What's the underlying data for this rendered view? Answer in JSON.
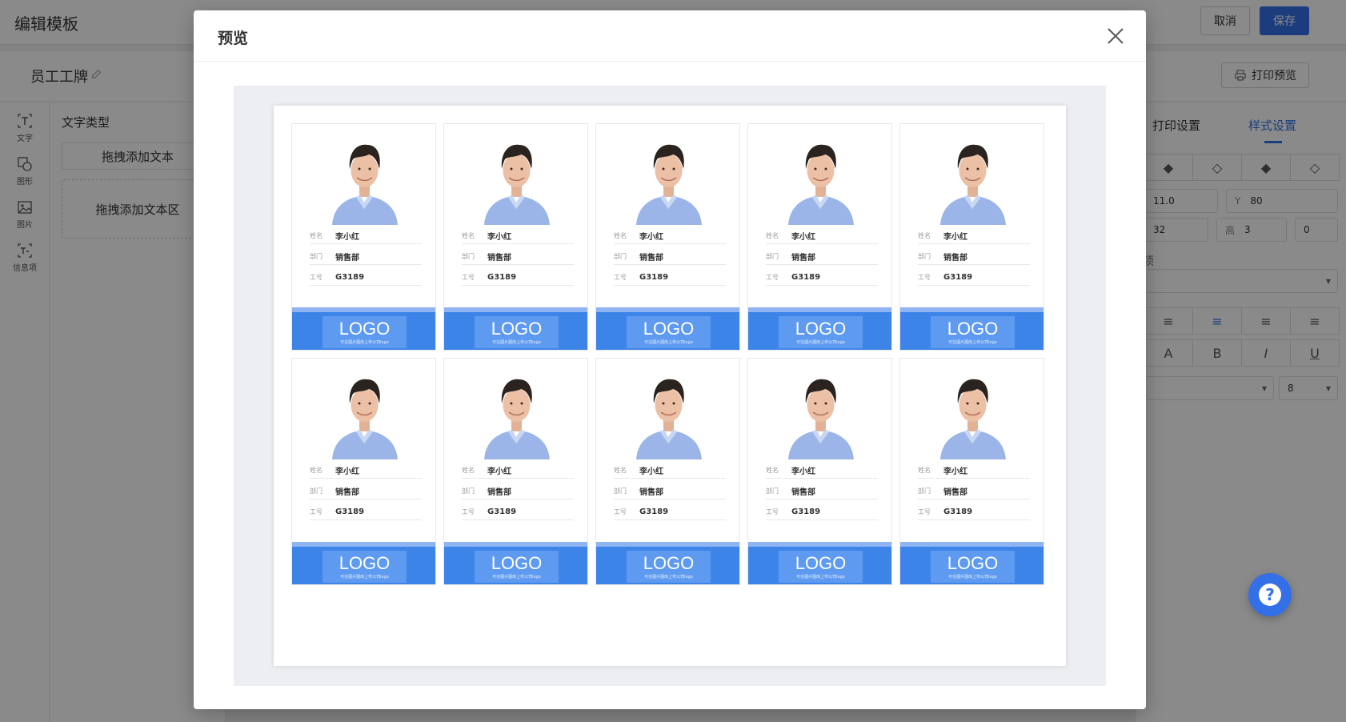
{
  "editor": {
    "title": "编辑模板",
    "cancel_label": "取消",
    "save_label": "保存",
    "template_name": "员工工牌",
    "print_preview_label": "打印预览"
  },
  "toolbar": {
    "items": [
      {
        "label": "文字",
        "icon": "text-icon"
      },
      {
        "label": "图形",
        "icon": "shape-icon"
      },
      {
        "label": "图片",
        "icon": "image-icon"
      },
      {
        "label": "信息项",
        "icon": "info-field-icon"
      }
    ]
  },
  "left_panel": {
    "title": "文字类型",
    "add_text": "拖拽添加文本",
    "add_text_area": "拖拽添加文本区"
  },
  "right_panel": {
    "tabs": [
      "打印设置",
      "样式设置"
    ],
    "active_tab": "样式设置",
    "x_value": "11.0",
    "y_label": "Y",
    "y_value": "80",
    "w_value": "32",
    "h_label": "高",
    "h_value": "3",
    "rotate_value": "0",
    "section_label": "项",
    "font_size": "8",
    "format_buttons": [
      "A",
      "B",
      "I",
      "U"
    ]
  },
  "modal": {
    "title": "预览",
    "close_icon": "close-icon"
  },
  "badge": {
    "name_label": "姓名",
    "name_value": "李小红",
    "dept_label": "部门",
    "dept_value": "销售部",
    "id_label": "工号",
    "id_value": "G3189",
    "logo_text": "LOGO",
    "logo_hint": "可在图片图库上传公司logo",
    "rows": 2,
    "columns": 5
  },
  "colors": {
    "accent": "#3370e8",
    "badge_footer": "#3d84e8",
    "badge_logo_box": "#5e9af0",
    "badge_strip": "#8fb4f2"
  },
  "help_icon": "help-icon"
}
